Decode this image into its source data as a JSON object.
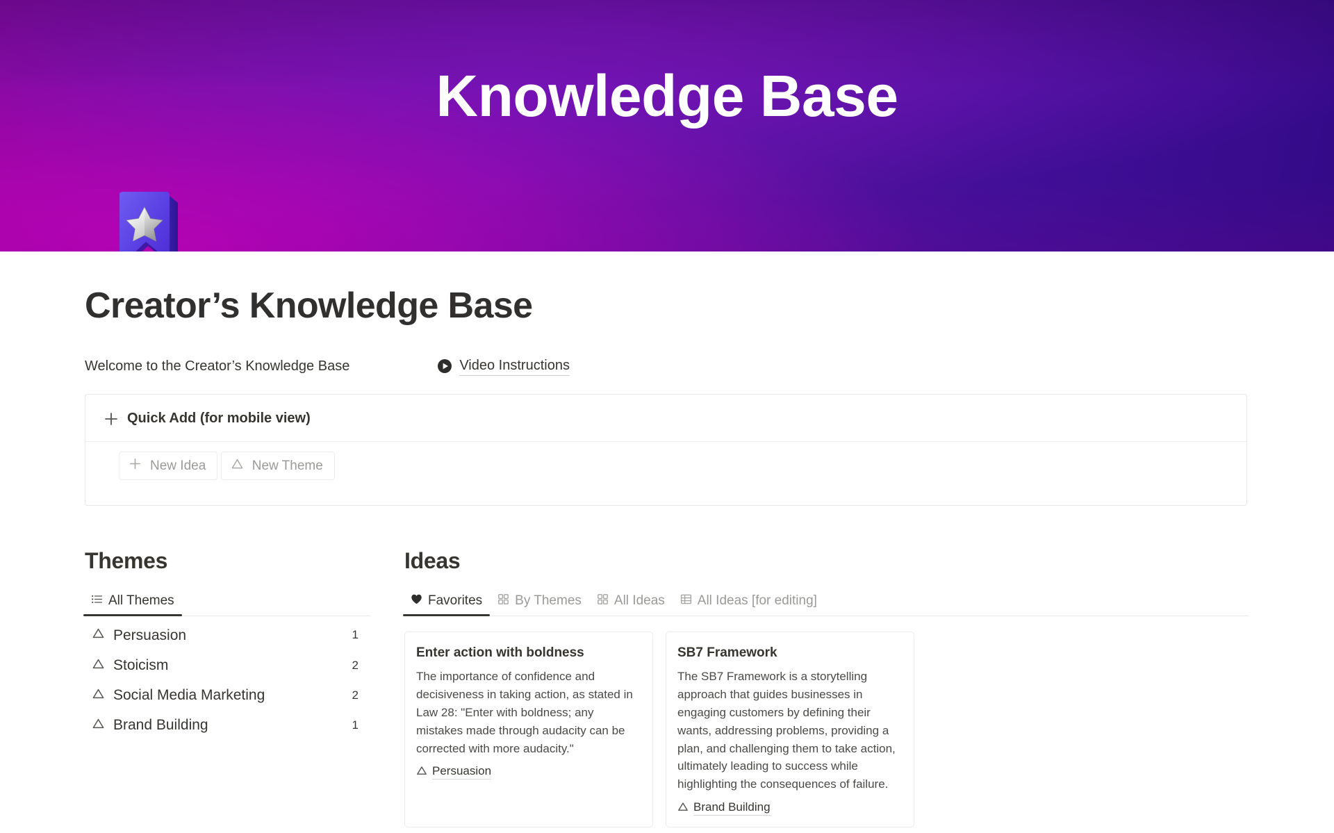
{
  "banner": {
    "title": "Knowledge Base",
    "icon": "bookmark-star-icon",
    "gradient_from": "#8a069b",
    "gradient_to": "#340a88",
    "accent_magenta": "#d600c5"
  },
  "page": {
    "title": "Creator’s Knowledge Base",
    "welcome_text": "Welcome to the Creator’s Knowledge Base",
    "video_link_label": "Video Instructions",
    "video_link_icon": "play-circle-icon"
  },
  "quick_add": {
    "toggle_icon": "plus-icon",
    "title": "Quick Add (for mobile view)",
    "buttons": [
      {
        "label": "New Idea",
        "icon": "plus-icon"
      },
      {
        "label": "New Theme",
        "icon": "triangle-icon"
      }
    ]
  },
  "themes": {
    "heading": "Themes",
    "tabs": [
      {
        "label": "All Themes",
        "icon": "list-icon",
        "active": true
      }
    ],
    "items": [
      {
        "name": "Persuasion",
        "count": "1",
        "icon": "triangle-icon"
      },
      {
        "name": "Stoicism",
        "count": "2",
        "icon": "triangle-icon"
      },
      {
        "name": "Social Media Marketing",
        "count": "2",
        "icon": "triangle-icon"
      },
      {
        "name": "Brand Building",
        "count": "1",
        "icon": "triangle-icon"
      }
    ]
  },
  "ideas": {
    "heading": "Ideas",
    "tabs": [
      {
        "label": "Favorites",
        "icon": "heart-icon",
        "active": true
      },
      {
        "label": "By Themes",
        "icon": "gallery-icon",
        "active": false
      },
      {
        "label": "All Ideas",
        "icon": "gallery-icon",
        "active": false
      },
      {
        "label": "All Ideas [for editing]",
        "icon": "table-icon",
        "active": false
      }
    ],
    "cards": [
      {
        "title": "Enter action with boldness",
        "description": "The importance of confidence and decisiveness in taking action, as stated in Law 28: \"Enter with boldness; any mistakes made through audacity can be corrected with more audacity.\"",
        "tag": "Persuasion",
        "tag_icon": "triangle-icon"
      },
      {
        "title": "SB7 Framework",
        "description": "The SB7 Framework is a storytelling approach that guides businesses in engaging customers by defining their wants, addressing problems, providing a plan, and challenging them to take action, ultimately leading to success while highlighting the consequences of failure.",
        "tag": "Brand Building",
        "tag_icon": "triangle-icon"
      }
    ]
  }
}
